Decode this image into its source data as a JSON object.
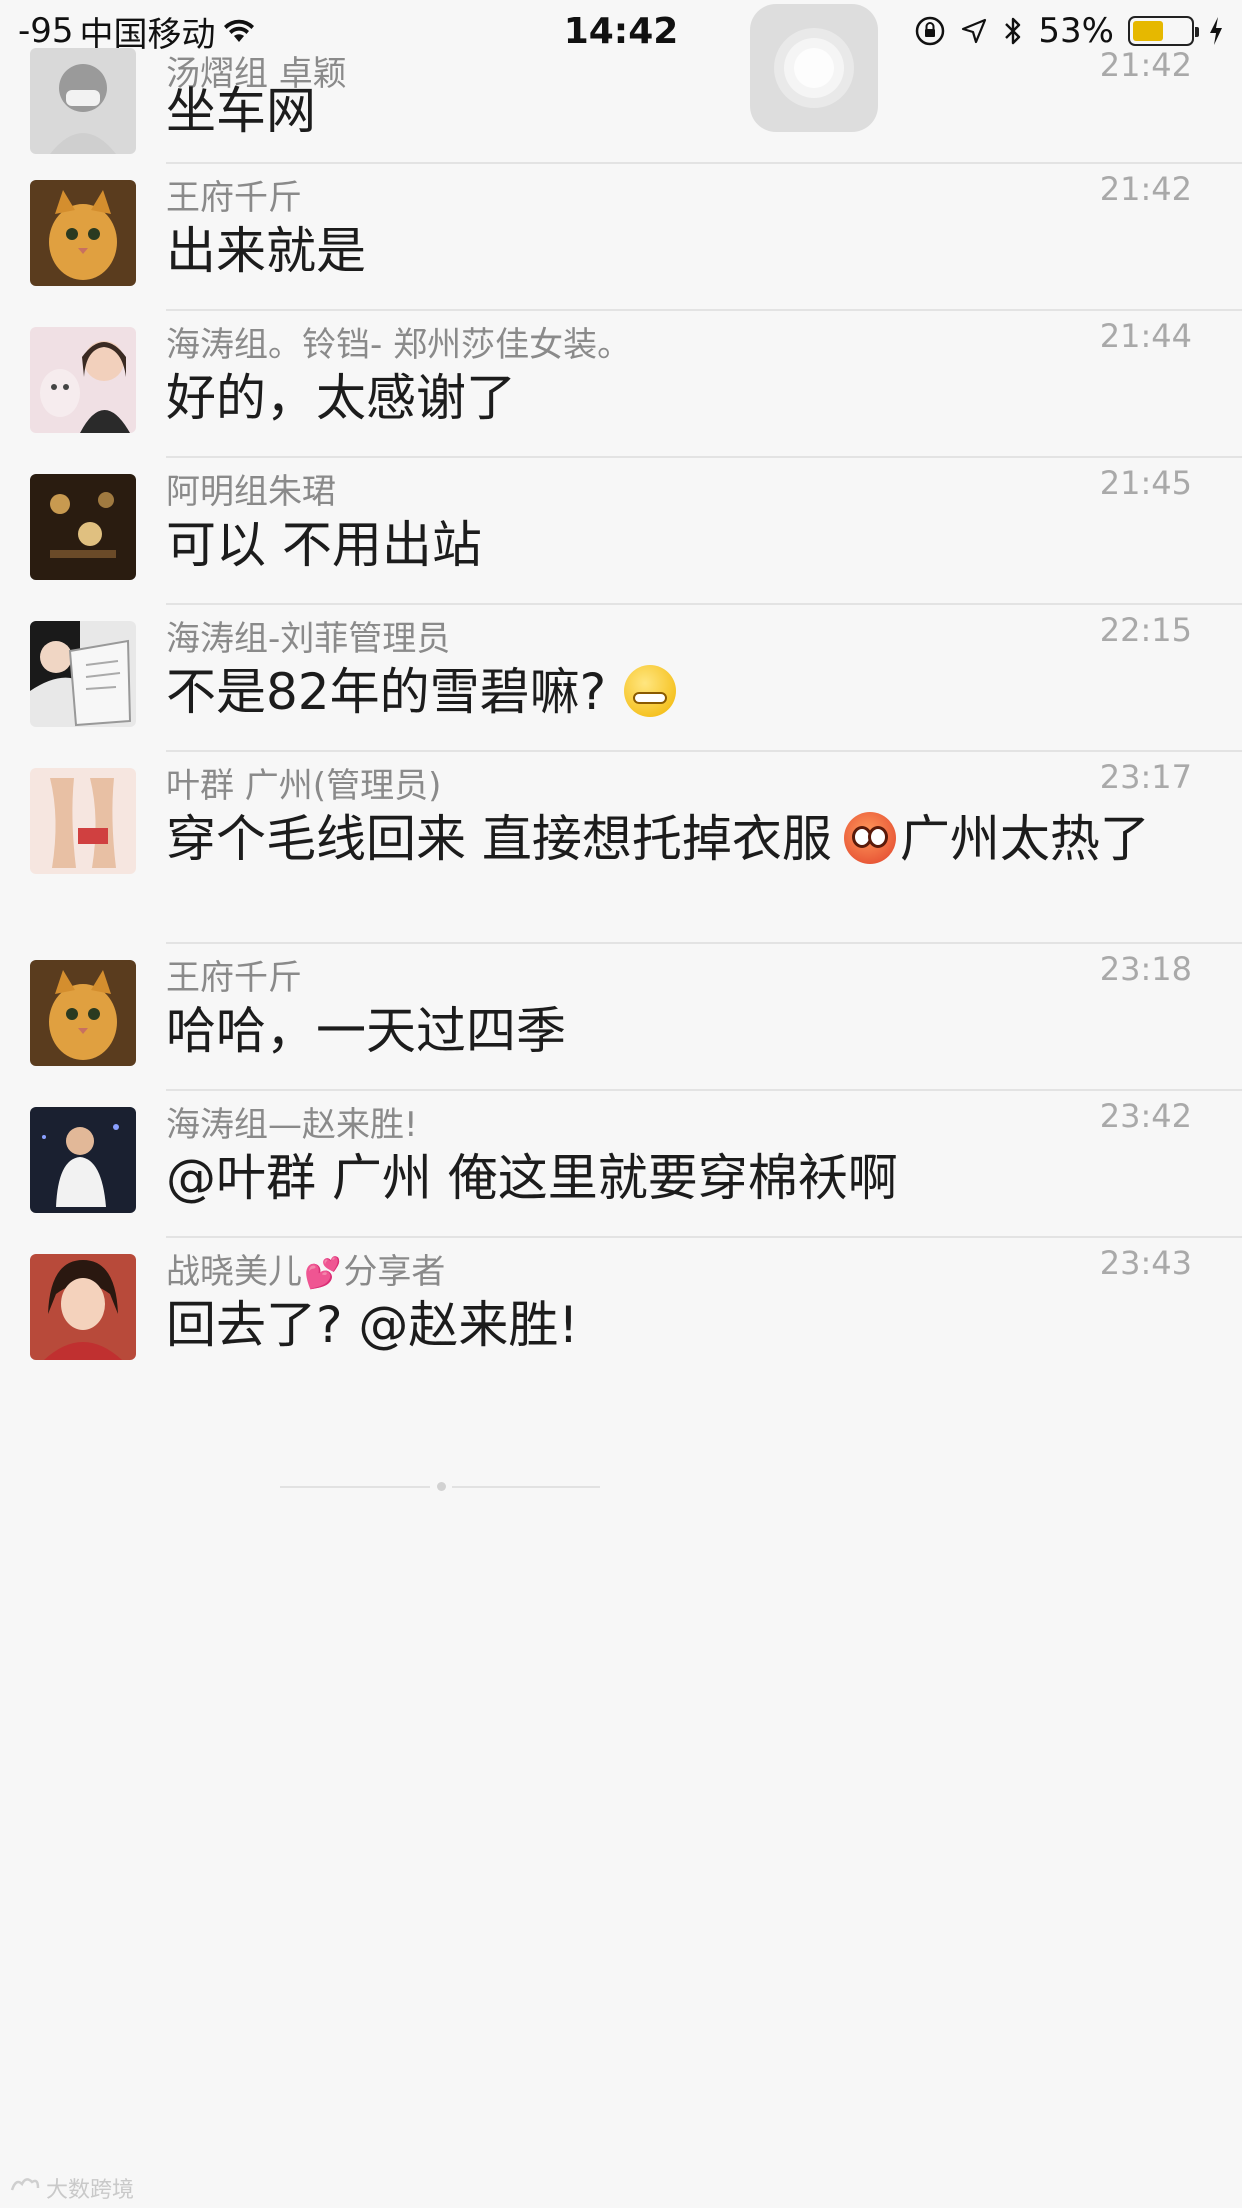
{
  "status_bar": {
    "signal": "-95",
    "carrier": "中国移动",
    "time": "14:42",
    "battery_percent": "53%",
    "battery_level": 0.53,
    "icons": [
      "wifi-icon",
      "orientation-lock-icon",
      "location-icon",
      "bluetooth-icon",
      "battery-icon",
      "charging-icon"
    ]
  },
  "messages": [
    {
      "name": "汤熠组 卓颖",
      "time": "21:42",
      "text": "坐车网"
    },
    {
      "name": "王府千斤",
      "time": "21:42",
      "text": "出来就是"
    },
    {
      "name": "海涛组。铃铛- 郑州莎佳女装。",
      "time": "21:44",
      "text": "好的，太感谢了"
    },
    {
      "name": "阿明组朱珺",
      "time": "21:45",
      "text": "可以 不用出站"
    },
    {
      "name": "海涛组-刘菲管理员",
      "time": "22:15",
      "text": "不是82年的雪碧嘛?"
    },
    {
      "name": "叶群 广州(管理员)",
      "time": "23:17",
      "text_a": "穿个毛线回来 直接想托掉衣服",
      "text_b": "广州太热了"
    },
    {
      "name": "王府千斤",
      "time": "23:18",
      "text": "哈哈，一天过四季"
    },
    {
      "name": "海涛组—赵来胜!",
      "time": "23:42",
      "text": "@叶群 广州 俺这里就要穿棉袄啊"
    },
    {
      "name_a": "战晓美儿",
      "name_b": "分享者",
      "time": "23:43",
      "text": "回去了? @赵来胜!"
    }
  ],
  "watermark": "大数跨境",
  "colors": {
    "background": "#f7f7f7",
    "name": "#8a8a8a",
    "time": "#a9a9a9",
    "text": "#1c1c1c",
    "battery": "#e6b800"
  }
}
